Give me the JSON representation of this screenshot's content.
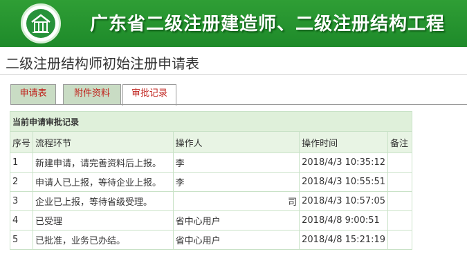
{
  "banner": {
    "title": "广东省二级注册建造师、二级注册结构工程"
  },
  "page": {
    "title": "二级注册结构师初始注册申请表"
  },
  "tabs": [
    {
      "label": "申请表",
      "active": false
    },
    {
      "label": "附件资料",
      "active": false
    },
    {
      "label": "审批记录",
      "active": true
    }
  ],
  "records": {
    "caption": "当前申请审批记录",
    "columns": [
      "序号",
      "流程环节",
      "操作人",
      "操作时间",
      "备注"
    ],
    "rows": [
      {
        "no": "1",
        "step": "新建申请，请完善资料后上报。",
        "operator": "李",
        "time": "2018/4/3 10:35:12",
        "remark": ""
      },
      {
        "no": "2",
        "step": "申请人已上报，等待企业上报。",
        "operator": "李",
        "time": "2018/4/3 10:55:51",
        "remark": ""
      },
      {
        "no": "3",
        "step": "企业已上报，等待省级受理。",
        "operator": "司",
        "time": "2018/4/3 10:57:05",
        "remark": ""
      },
      {
        "no": "4",
        "step": "已受理",
        "operator": "省中心用户",
        "time": "2018/4/8 9:00:51",
        "remark": ""
      },
      {
        "no": "5",
        "step": "已批准，业务已办结。",
        "operator": "省中心用户",
        "time": "2018/4/8 15:21:19",
        "remark": ""
      }
    ]
  },
  "colors": {
    "banner_green": "#1e8a2a",
    "tab_text_red": "#c0221c",
    "table_header_green": "#dff0da"
  }
}
